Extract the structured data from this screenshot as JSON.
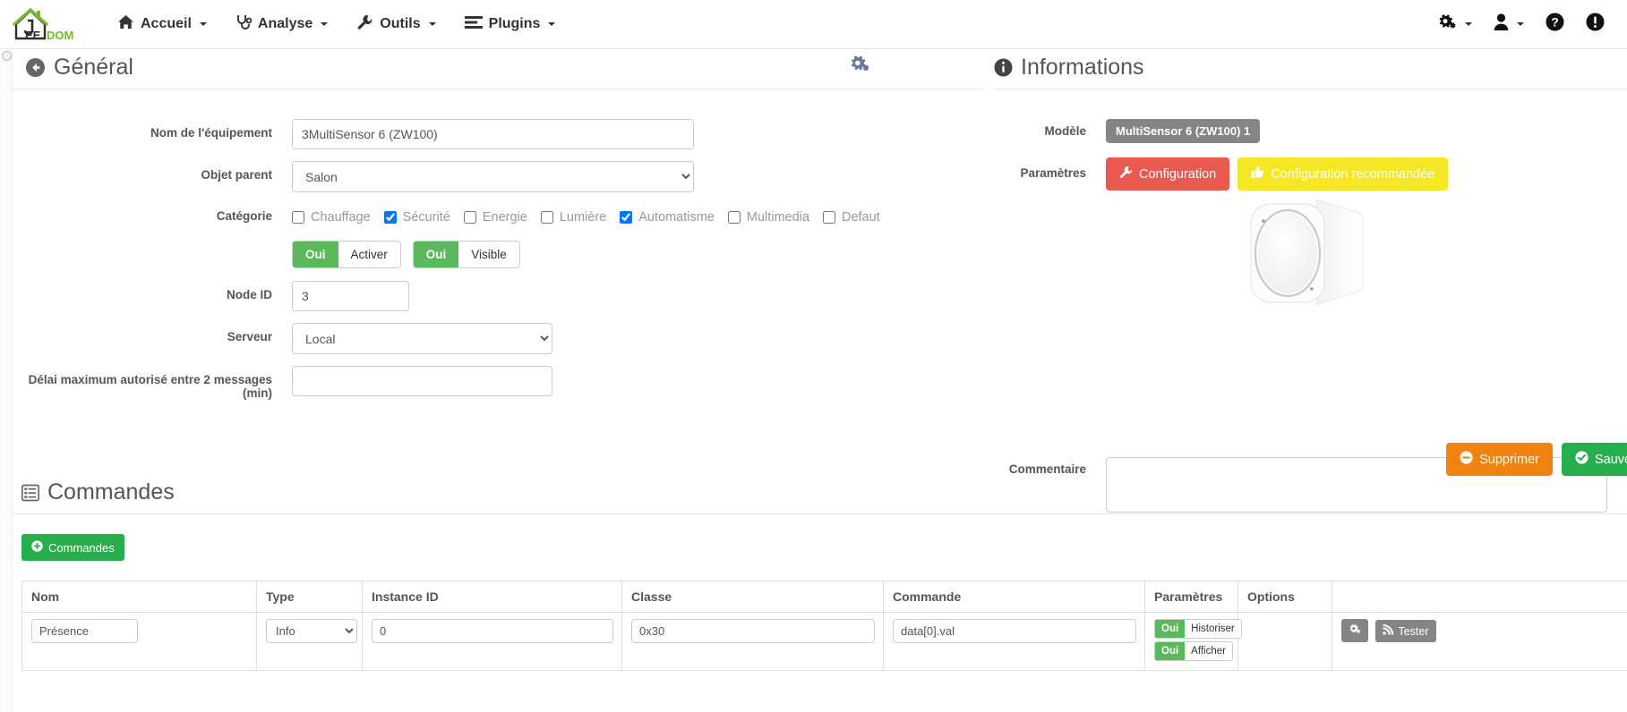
{
  "navbar": {
    "brand": "JEEDOM",
    "brand_parts": {
      "prefix": "J",
      "mid": "EE",
      "suffix": "DOM"
    },
    "items": [
      {
        "label": "Accueil",
        "icon": "home-icon",
        "caret": true
      },
      {
        "label": "Analyse",
        "icon": "stethoscope-icon",
        "caret": true
      },
      {
        "label": "Outils",
        "icon": "wrench-icon",
        "caret": true
      },
      {
        "label": "Plugins",
        "icon": "plugins-icon",
        "caret": true
      }
    ],
    "right_items": [
      {
        "label": "",
        "icon": "gears-icon",
        "caret": true
      },
      {
        "label": "",
        "icon": "user-icon",
        "caret": true
      },
      {
        "label": "",
        "icon": "help-circle-icon",
        "caret": false
      },
      {
        "label": "",
        "icon": "warning-circle-icon",
        "caret": false
      }
    ]
  },
  "general": {
    "legend": "Général",
    "back_icon": "back-arrow-icon",
    "gear_icon": "gears-icon",
    "fields": {
      "nom_label": "Nom de l'équipement",
      "nom_value": "3MultiSensor 6 (ZW100)",
      "objet_label": "Objet parent",
      "objet_value": "Salon",
      "objet_options": [
        "Salon"
      ],
      "categorie_label": "Catégorie",
      "node_label": "Node ID",
      "node_value": "3",
      "serveur_label": "Serveur",
      "serveur_value": "Local",
      "serveur_options": [
        "Local"
      ],
      "delai_label": "Délai maximum autorisé entre 2 messages (min)",
      "delai_value": ""
    },
    "categories": [
      {
        "label": "Chauffage",
        "checked": false
      },
      {
        "label": "Sécurité",
        "checked": true
      },
      {
        "label": "Energie",
        "checked": false
      },
      {
        "label": "Lumière",
        "checked": false
      },
      {
        "label": "Automatisme",
        "checked": true
      },
      {
        "label": "Multimedia",
        "checked": false
      },
      {
        "label": "Defaut",
        "checked": false
      }
    ],
    "toggles": [
      {
        "on_label": "Oui",
        "off_label": "Activer"
      },
      {
        "on_label": "Oui",
        "off_label": "Visible"
      }
    ]
  },
  "informations": {
    "legend": "Informations",
    "info_icon": "info-circle-icon",
    "modele_label": "Modèle",
    "modele_value": "MultiSensor 6 (ZW100) 1",
    "parametres_label": "Paramètres",
    "btn_configuration": "Configuration",
    "btn_configuration_icon": "wrench-icon",
    "btn_configuration_reco": "Configuration recommandée",
    "btn_configuration_reco_icon": "thumbs-up-icon",
    "device_image_alt": "MultiSensor 6 device",
    "commentaire_label": "Commentaire",
    "commentaire_value": "",
    "btn_supprimer": "Supprimer",
    "btn_supprimer_icon": "minus-circle-icon",
    "btn_sauvegarder": "Sauvegarder",
    "btn_sauvegarder_icon": "check-circle-icon"
  },
  "commandes": {
    "legend": "Commandes",
    "legend_icon": "list-icon",
    "add_button": "Commandes",
    "add_button_icon": "plus-circle-icon",
    "headers": [
      "Nom",
      "Type",
      "Instance ID",
      "Classe",
      "Commande",
      "Paramètres",
      "Options",
      ""
    ],
    "rows": [
      {
        "nom": "Présence",
        "type": "Info",
        "type_options": [
          "Info"
        ],
        "instance_id": "0",
        "classe": "0x30",
        "commande": "data[0].val",
        "params": [
          {
            "on_label": "Oui",
            "off_label": "Historiser"
          },
          {
            "on_label": "Oui",
            "off_label": "Afficher"
          }
        ],
        "options": "",
        "actions": [
          {
            "label": "",
            "icon": "gears-icon"
          },
          {
            "label": "Tester",
            "icon": "rss-icon"
          }
        ]
      }
    ]
  },
  "colors": {
    "green": "#27ae4d",
    "toggle_green": "#5cb85c",
    "danger": "#e9594f",
    "warning": "#f5e626",
    "orange": "#f0820f",
    "gray_badge": "#858585",
    "brand_green": "#78b82a"
  }
}
